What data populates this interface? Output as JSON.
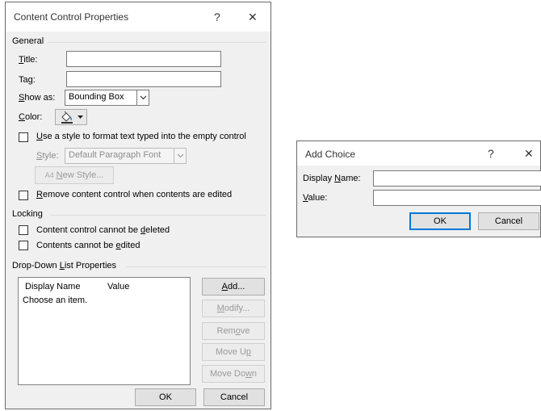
{
  "ccp": {
    "title": "Content Control Properties",
    "help": "?",
    "close": "✕",
    "general": {
      "label": "General",
      "title_label_pre": "",
      "title_label_u": "T",
      "title_label_post": "itle:",
      "tag_label_pre": "Ta",
      "tag_label_u": "g",
      "tag_label_post": ":",
      "show_as_label_pre": "",
      "show_as_label_u": "S",
      "show_as_label_post": "how as:",
      "show_as_value": "Bounding Box",
      "color_label_pre": "",
      "color_label_u": "C",
      "color_label_post": "olor:",
      "use_style_pre": "",
      "use_style_u": "U",
      "use_style_post": "se a style to format text typed into the empty control",
      "style_label_pre": "",
      "style_label_u": "S",
      "style_label_post": "tyle:",
      "style_value": "Default Paragraph Font",
      "new_style_pre": "",
      "new_style_u": "N",
      "new_style_post": "ew Style...",
      "remove_pre": "",
      "remove_u": "R",
      "remove_post": "emove content control when contents are edited"
    },
    "locking": {
      "label": "Locking",
      "cannot_delete_pre": "Content control cannot be ",
      "cannot_delete_u": "d",
      "cannot_delete_post": "eleted",
      "cannot_edit_pre": "Contents cannot be ",
      "cannot_edit_u": "e",
      "cannot_edit_post": "dited"
    },
    "dropdown": {
      "label_pre": "Drop-Down ",
      "label_u": "L",
      "label_post": "ist Properties",
      "col_display": "Display Name",
      "col_value": "Value",
      "items": [
        "Choose an item."
      ],
      "add_pre": "",
      "add_u": "A",
      "add_post": "dd...",
      "modify_pre": "",
      "modify_u": "M",
      "modify_post": "odify...",
      "remove_pre": "Rem",
      "remove_u": "o",
      "remove_post": "ve",
      "move_up_pre": "Move U",
      "move_up_u": "p",
      "move_up_post": "",
      "move_down_pre": "Move Do",
      "move_down_u": "w",
      "move_down_post": "n"
    },
    "ok": "OK",
    "cancel": "Cancel"
  },
  "add_choice": {
    "title": "Add Choice",
    "help": "?",
    "close": "✕",
    "display_name_pre": "Display ",
    "display_name_u": "N",
    "display_name_post": "ame:",
    "value_pre": "",
    "value_u": "V",
    "value_post": "alue:",
    "display_name_value": "",
    "value_value": "",
    "ok": "OK",
    "cancel": "Cancel"
  }
}
